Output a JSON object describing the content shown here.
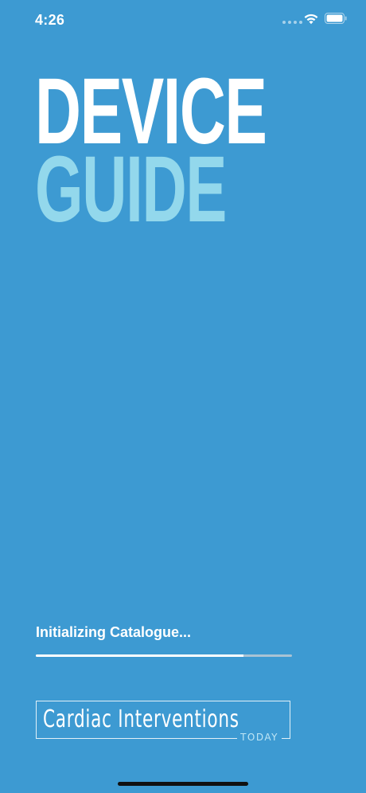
{
  "status_bar": {
    "time": "4:26",
    "icons": [
      "signal-dots-icon",
      "wifi-icon",
      "battery-icon"
    ]
  },
  "logo": {
    "line1": "DEVICE",
    "line2": "GUIDE",
    "line1_color": "#ffffff",
    "line2_color": "#93d8ec"
  },
  "loading": {
    "label": "Initializing Catalogue...",
    "progress": 0.81
  },
  "brand": {
    "name": "Cardiac Interventions",
    "sub": "TODAY"
  },
  "colors": {
    "background": "#3d9ad2",
    "accent_light": "#93d8ec",
    "progress_track": "#a9c3d4"
  }
}
